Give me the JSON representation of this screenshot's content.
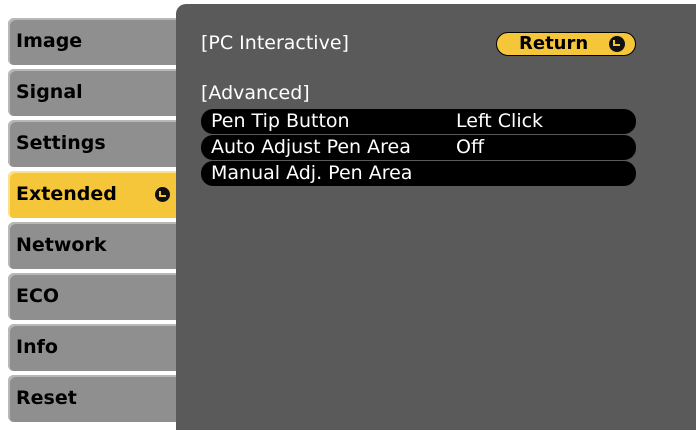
{
  "menu": {
    "tabs": [
      {
        "label": "Image",
        "active": false
      },
      {
        "label": "Signal",
        "active": false
      },
      {
        "label": "Settings",
        "active": false
      },
      {
        "label": "Extended",
        "active": true
      },
      {
        "label": "Network",
        "active": false
      },
      {
        "label": "ECO",
        "active": false
      },
      {
        "label": "Info",
        "active": false
      },
      {
        "label": "Reset",
        "active": false
      }
    ]
  },
  "panel": {
    "title": "[PC Interactive]",
    "return_label": "Return",
    "section_label": "[Advanced]",
    "rows": [
      {
        "label": "Pen Tip Button",
        "value": "Left Click"
      },
      {
        "label": "Auto Adjust Pen Area",
        "value": "Off"
      },
      {
        "label": "Manual Adj. Pen Area",
        "value": ""
      }
    ]
  },
  "colors": {
    "accent": "#f5c63a",
    "tab_inactive": "#8f8f8f",
    "panel_bg": "#5a5a5a",
    "row_bg": "#000000"
  },
  "icons": {
    "enter": "enter-icon"
  }
}
